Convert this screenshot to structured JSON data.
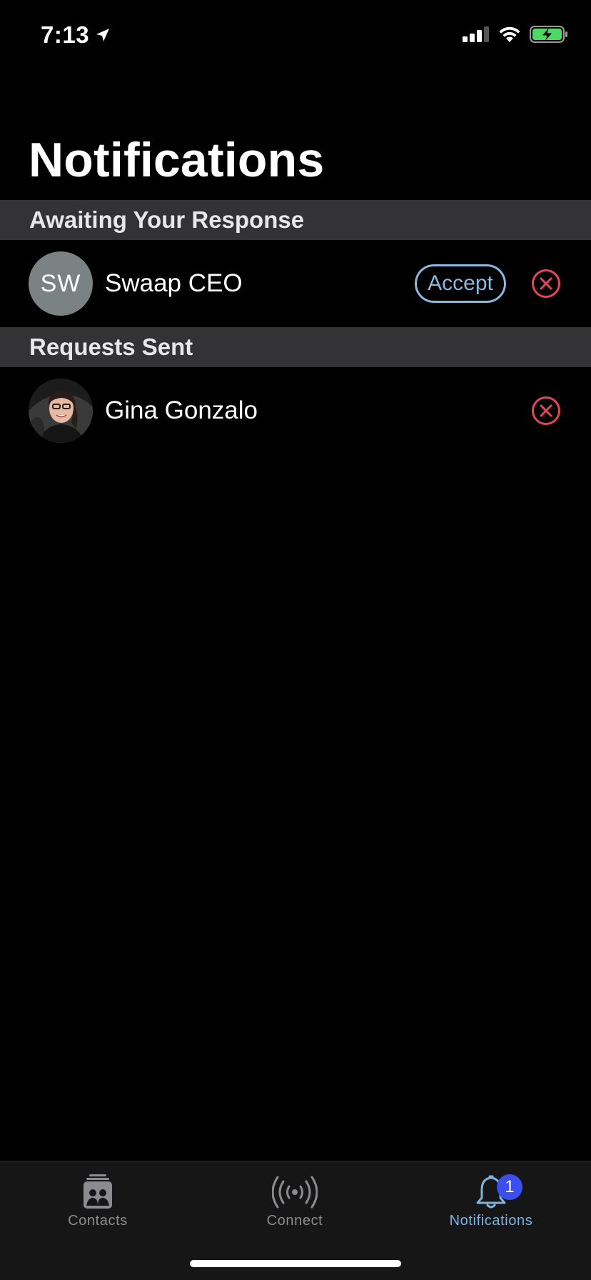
{
  "status_bar": {
    "time": "7:13"
  },
  "page": {
    "title": "Notifications"
  },
  "sections": {
    "awaiting": {
      "header": "Awaiting Your Response",
      "item": {
        "initials": "SW",
        "name": "Swaap CEO",
        "accept_label": "Accept"
      }
    },
    "sent": {
      "header": "Requests Sent",
      "item": {
        "name": "Gina Gonzalo"
      }
    }
  },
  "tabs": [
    {
      "label": "Contacts",
      "icon": "contacts-icon",
      "active": false
    },
    {
      "label": "Connect",
      "icon": "broadcast-icon",
      "active": false
    },
    {
      "label": "Notifications",
      "icon": "bell-icon",
      "active": true,
      "badge": "1"
    }
  ],
  "colors": {
    "accent": "#7fb2de",
    "decline": "#e0485a",
    "badge": "#3b4ff0",
    "section_bg": "#333336"
  }
}
